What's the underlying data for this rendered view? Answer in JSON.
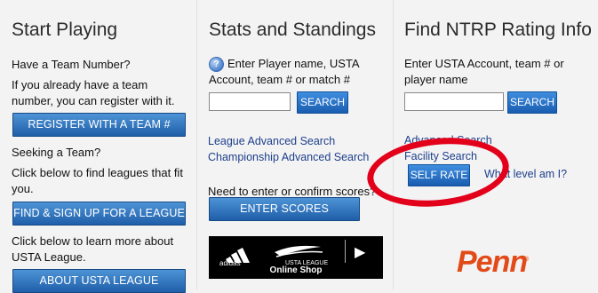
{
  "start_playing": {
    "heading": "Start Playing",
    "have_team_number": "Have a Team Number?",
    "if_already_line1": "If you already have a team",
    "if_already_line2": "number, you can register with it.",
    "register_button": "REGISTER WITH A TEAM #",
    "seeking_team": "Seeking a Team?",
    "click_find_line1": "Click below to find leagues that fit",
    "click_find_line2": "you.",
    "find_button": "FIND & SIGN UP FOR A LEAGUE",
    "click_learn_line1": "Click below to learn more about",
    "click_learn_line2": "USTA League.",
    "about_button": "ABOUT USTA LEAGUE"
  },
  "stats": {
    "heading": "Stats and Standings",
    "help_icon": "?",
    "prompt_line1": "Enter Player name, USTA",
    "prompt_line2": "Account, team # or match #",
    "search_value": "",
    "search_button": "SEARCH",
    "league_advanced": "League Advanced Search",
    "championship_advanced": "Championship Advanced Search",
    "enter_scores_prompt": "Need to enter or confirm scores?",
    "enter_scores_button": "ENTER SCORES",
    "banner": {
      "adidas": "adidas",
      "usta_league": "USTA LEAGUE",
      "online_shop": "Online Shop",
      "play_icon": "▶"
    }
  },
  "ntrp": {
    "heading": "Find NTRP Rating Info",
    "prompt_line1": "Enter USTA Account, team # or",
    "prompt_line2": "player name",
    "search_value": "",
    "search_button": "SEARCH",
    "advanced_search": "Advanced Search",
    "facility_search": "Facility Search",
    "self_rate_button": "SELF RATE",
    "what_level": "What level am I?",
    "penn_logo": "Penn",
    "penn_mark": "®"
  },
  "annotation": {
    "circle_color": "#e2001a"
  }
}
